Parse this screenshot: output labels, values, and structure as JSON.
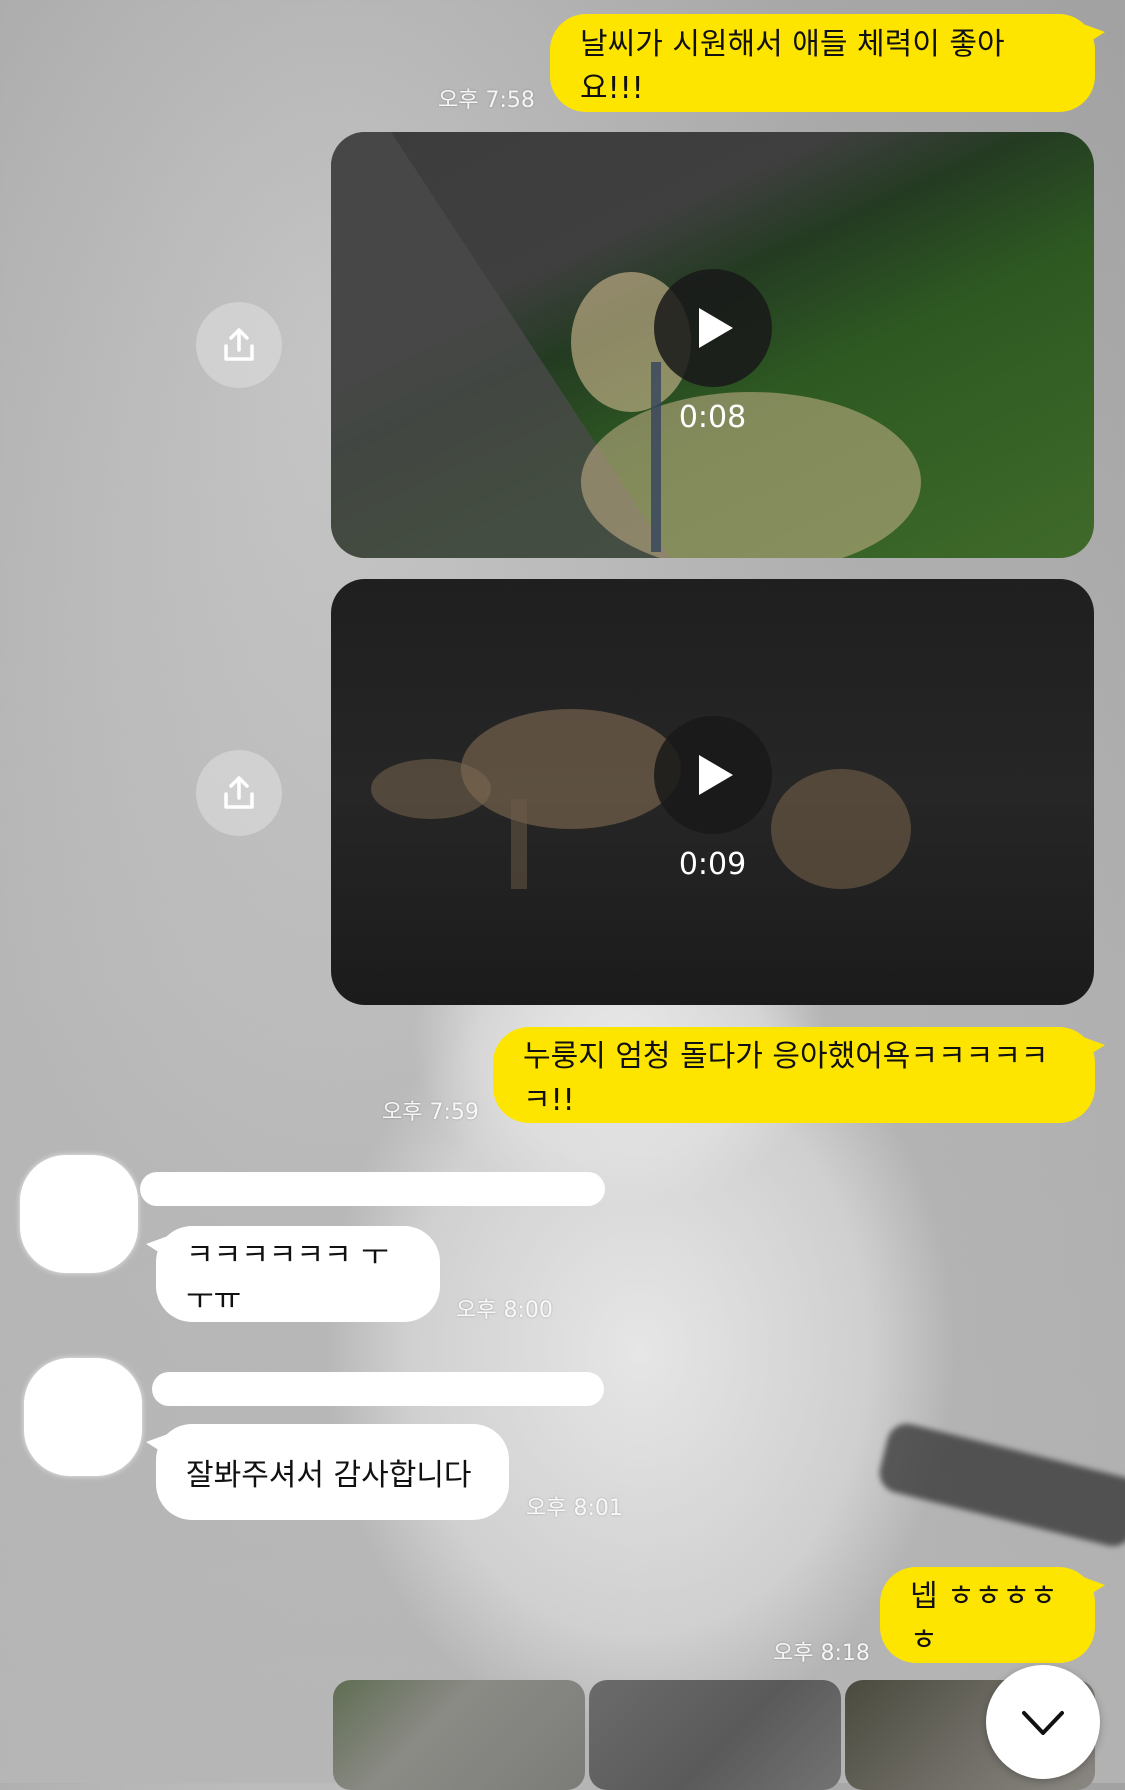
{
  "messages": {
    "m1": {
      "text": "날씨가 시원해서 애들 체력이 좋아요!!!",
      "time": "오후 7:58"
    },
    "video1": {
      "duration": "0:08"
    },
    "video2": {
      "duration": "0:09"
    },
    "m2": {
      "text": "누룽지 엄청 돌다가 응아했어욕ㅋㅋㅋㅋㅋㅋ!!",
      "time": "오후 7:59"
    },
    "r1": {
      "text": "ㅋㅋㅋㅋㅋㅋ ㅜㅜㅠ",
      "time": "오후 8:00"
    },
    "r2": {
      "text": "잘봐주셔서 감사합니다",
      "time": "오후 8:01"
    },
    "m3": {
      "text": "넵 ㅎㅎㅎㅎㅎ",
      "time": "오후 8:18"
    }
  },
  "icons": {
    "share": "share-upload-icon",
    "play": "play-icon",
    "scroll_down": "chevron-down-icon"
  },
  "colors": {
    "my_bubble": "#fee500",
    "their_bubble": "#ffffff"
  }
}
